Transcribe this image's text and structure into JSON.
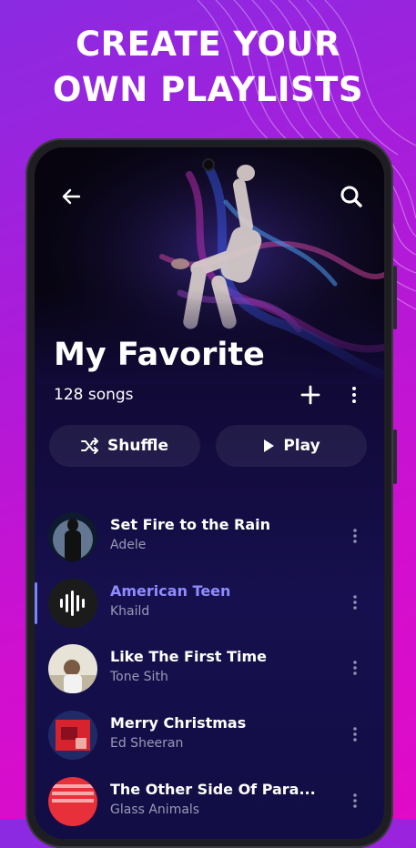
{
  "promo": {
    "line1": "CREATE YOUR",
    "line2": "OWN PLAYLISTS"
  },
  "colors": {
    "background": "#b01ad8",
    "accent": "#8f8cff",
    "screen": "#120a3a"
  },
  "header": {
    "back_icon": "arrow-left-icon",
    "search_icon": "search-icon"
  },
  "playlist": {
    "title": "My Favorite",
    "song_count": "128 songs",
    "add_icon": "plus-icon",
    "more_icon": "more-vertical-icon"
  },
  "actions": {
    "shuffle_label": "Shuffle",
    "play_label": "Play"
  },
  "songs": [
    {
      "title": "Set Fire to the Rain",
      "artist": "Adele"
    },
    {
      "title": "American Teen",
      "artist": "Khaild",
      "playing": true
    },
    {
      "title": "Like The First Time",
      "artist": "Tone Sith"
    },
    {
      "title": "Merry Christmas",
      "artist": "Ed Sheeran"
    },
    {
      "title": "The Other Side Of Para...",
      "artist": "Glass Animals"
    }
  ]
}
